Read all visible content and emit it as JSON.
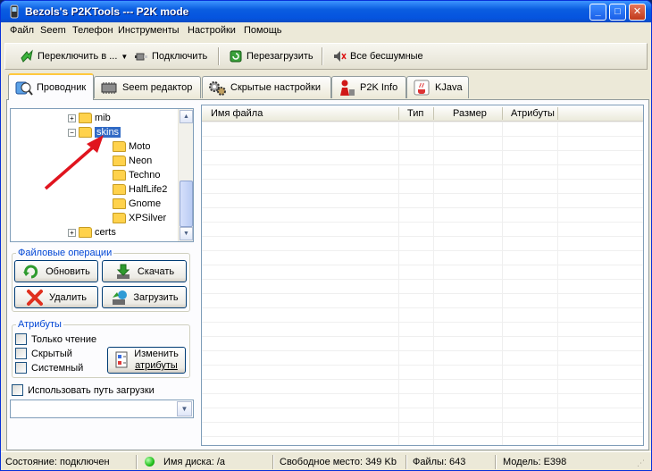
{
  "window": {
    "title": "Bezols's P2KTools --- P2K mode",
    "controls": {
      "minimize": "_",
      "maximize": "□",
      "close": "✕"
    }
  },
  "menu": {
    "items": [
      "Файл",
      "Seem",
      "Телефон",
      "Инструменты",
      "Настройки",
      "Помощь"
    ]
  },
  "toolbar": {
    "switch_label": "Переключить в ...",
    "connect_label": "Подключить",
    "reboot_label": "Перезагрузить",
    "silent_label": "Все бесшумные"
  },
  "tabs": [
    "Проводник",
    "Seem редактор",
    "Скрытые настройки",
    "P2K Info",
    "KJava"
  ],
  "tree": {
    "items": [
      {
        "label": "mib"
      },
      {
        "label": "skins",
        "selected": true
      },
      {
        "label": "Moto"
      },
      {
        "label": "Neon"
      },
      {
        "label": "Techno"
      },
      {
        "label": "HalfLife2"
      },
      {
        "label": "Gnome"
      },
      {
        "label": "XPSilver"
      },
      {
        "label": "certs"
      }
    ]
  },
  "file_ops": {
    "title": "Файловые операции",
    "refresh": "Обновить",
    "download": "Скачать",
    "delete": "Удалить",
    "upload": "Загрузить"
  },
  "attributes": {
    "title": "Атрибуты",
    "readonly": "Только чтение",
    "hidden": "Скрытый",
    "system": "Системный",
    "change_line1": "Изменить",
    "change_line2": "атрибуты"
  },
  "upload_path": {
    "label": "Использовать путь загрузки",
    "value": ""
  },
  "file_list": {
    "columns": [
      "Имя файла",
      "Тип",
      "Размер",
      "Атрибуты"
    ]
  },
  "status": {
    "state": "Состояние: подключен",
    "disk": "Имя диска: /a",
    "free": "Свободное место: 349 Kb",
    "files": "Файлы: 643",
    "model": "Модель: E398"
  },
  "colors": {
    "accent": "#0554df",
    "selection": "#316ac5",
    "arrow": "#e0141e"
  }
}
